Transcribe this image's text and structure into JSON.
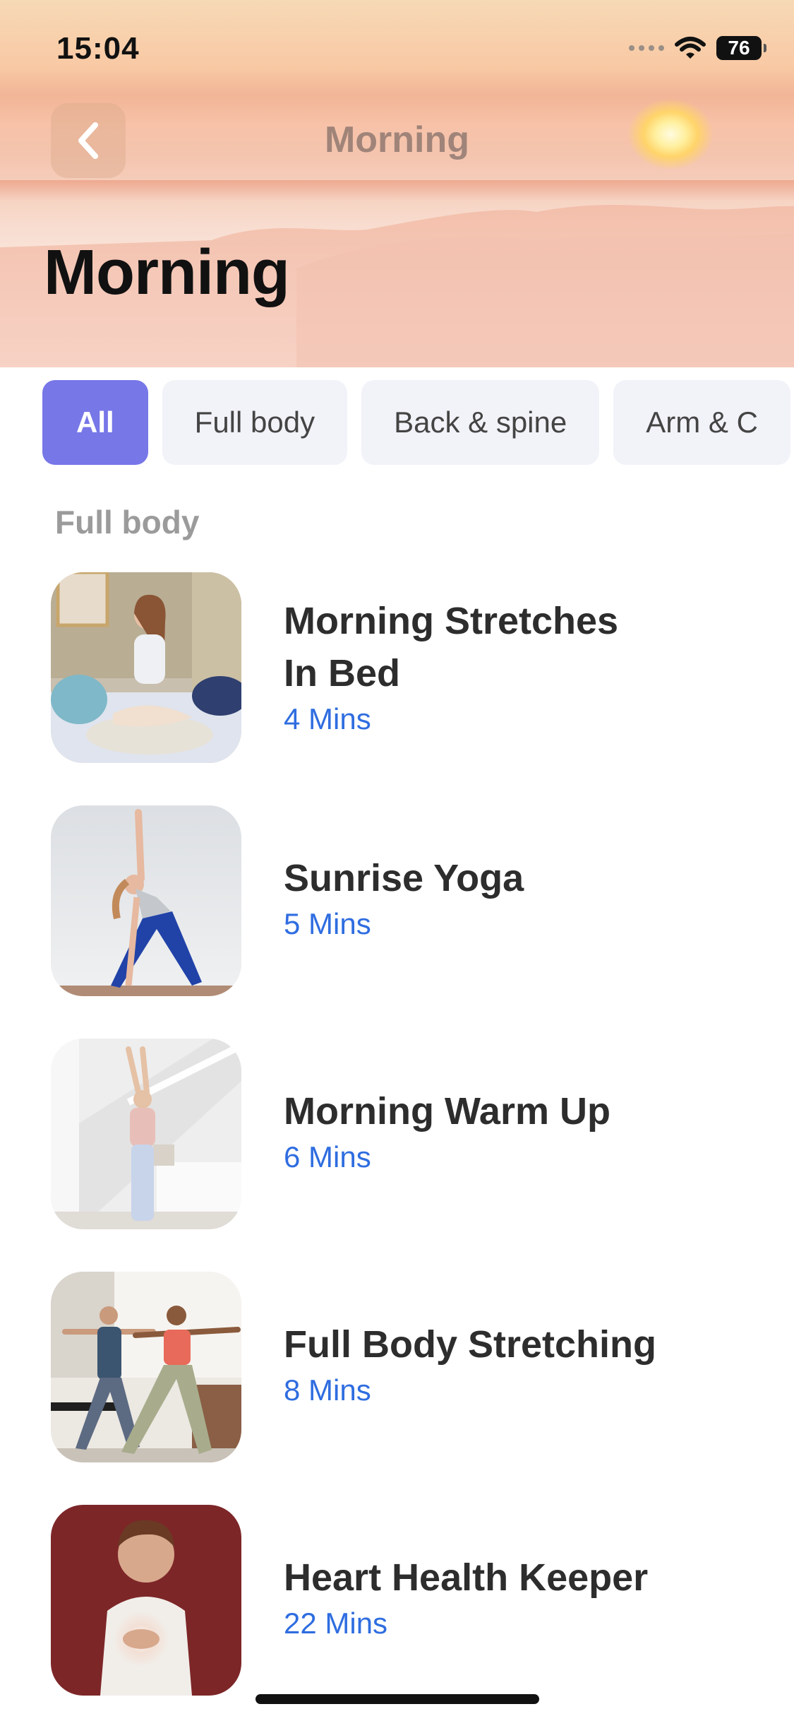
{
  "status_bar": {
    "time": "15:04",
    "battery": "76"
  },
  "nav": {
    "title": "Morning"
  },
  "page": {
    "title": "Morning"
  },
  "filters": [
    {
      "label": "All",
      "active": true
    },
    {
      "label": "Full body",
      "active": false
    },
    {
      "label": "Back & spine",
      "active": false
    },
    {
      "label": "Arm & C",
      "active": false
    }
  ],
  "section": {
    "label": "Full body"
  },
  "workouts": [
    {
      "title_line1": "Morning Stretches",
      "title_line2": "In Bed",
      "duration": "4 Mins"
    },
    {
      "title_line1": "Sunrise Yoga",
      "duration": "5 Mins"
    },
    {
      "title_line1": "Morning Warm Up",
      "duration": "6 Mins"
    },
    {
      "title_line1": "Full Body Stretching",
      "duration": "8 Mins"
    },
    {
      "title_line1": "Heart Health Keeper",
      "duration": "22 Mins"
    }
  ],
  "colors": {
    "accent": "#7777e8",
    "duration": "#2f6de0",
    "chip_bg": "#f2f3f9"
  },
  "icons": [
    "back-chevron-icon",
    "wifi-icon",
    "cellular-signal-icon",
    "battery-icon"
  ]
}
